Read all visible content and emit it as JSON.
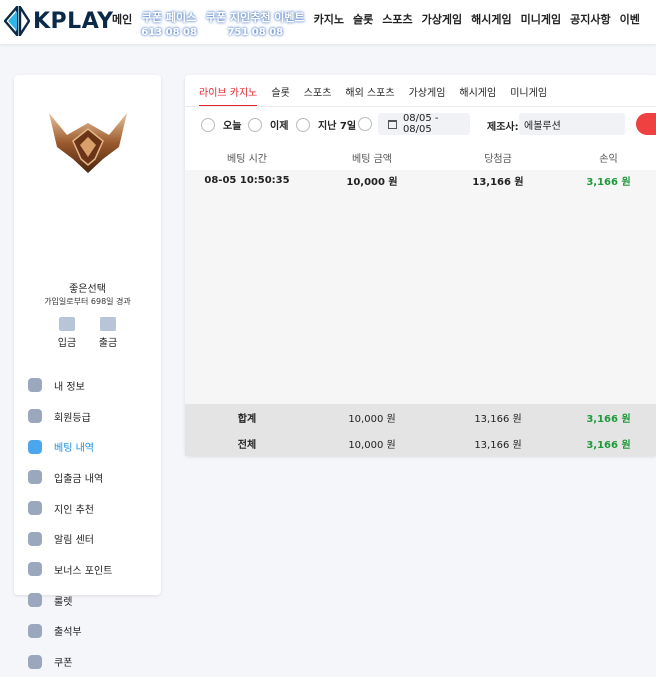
{
  "header": {
    "logo_text": "KPLAY",
    "nav": [
      {
        "label": "메인",
        "promo": false
      },
      {
        "label": "쿠폰 페이스",
        "sub": "613 08 08",
        "promo": true
      },
      {
        "label": "쿠폰 지인추천 이벤트",
        "sub": "751 08 08",
        "promo": true
      },
      {
        "label": "카지노",
        "promo": false
      },
      {
        "label": "슬롯",
        "promo": false
      },
      {
        "label": "스포츠",
        "promo": false
      },
      {
        "label": "가상게임",
        "promo": false
      },
      {
        "label": "해시게임",
        "promo": false
      },
      {
        "label": "미니게임",
        "promo": false
      },
      {
        "label": "공지사항",
        "promo": false
      },
      {
        "label": "이벤",
        "promo": false
      }
    ]
  },
  "sidebar": {
    "username": "좋은선택",
    "member_since": "가입일로부터 698일 경과",
    "deposit_label": "입금",
    "withdraw_label": "출금",
    "menu": [
      {
        "label": "내 정보",
        "icon": "user-icon",
        "active": false
      },
      {
        "label": "회원등급",
        "icon": "shield-icon",
        "active": false
      },
      {
        "label": "베팅 내역",
        "icon": "betting-icon",
        "active": true
      },
      {
        "label": "입출금 내역",
        "icon": "wallet-icon",
        "active": false
      },
      {
        "label": "지인 추천",
        "icon": "heart-icon",
        "active": false
      },
      {
        "label": "알림 센터",
        "icon": "chat-icon",
        "active": false
      },
      {
        "label": "보너스 포인트",
        "icon": "coin-icon",
        "active": false
      },
      {
        "label": "룰렛",
        "icon": "roulette-icon",
        "active": false
      },
      {
        "label": "출석부",
        "icon": "calendar-icon",
        "active": false
      },
      {
        "label": "쿠폰",
        "icon": "coupon-icon",
        "active": false
      }
    ]
  },
  "tabs": [
    "라이브 카지노",
    "슬롯",
    "스포츠",
    "해외 스포츠",
    "가상게임",
    "해시게임",
    "미니게임"
  ],
  "filters": {
    "today": "오늘",
    "yesterday": "이제",
    "last7": "지난 7일",
    "date_range": "08/05 - 08/05",
    "vendor_label": "제조사:",
    "vendor_value": "에볼루션"
  },
  "table": {
    "headers": [
      "베팅 시간",
      "베팅 금액",
      "당첨금",
      "손익"
    ],
    "rows": [
      [
        "08-05 10:50:35",
        "10,000 원",
        "13,166 원",
        "3,166 원"
      ]
    ],
    "subtotal": {
      "label": "합계",
      "bet": "10,000 원",
      "win": "13,166 원",
      "profit": "3,166 원"
    },
    "total": {
      "label": "전체",
      "bet": "10,000 원",
      "win": "13,166 원",
      "profit": "3,166 원"
    }
  },
  "colors": {
    "accent": "#e5262d",
    "active_menu": "#1a8ee8",
    "profit": "#1e9a3a"
  }
}
